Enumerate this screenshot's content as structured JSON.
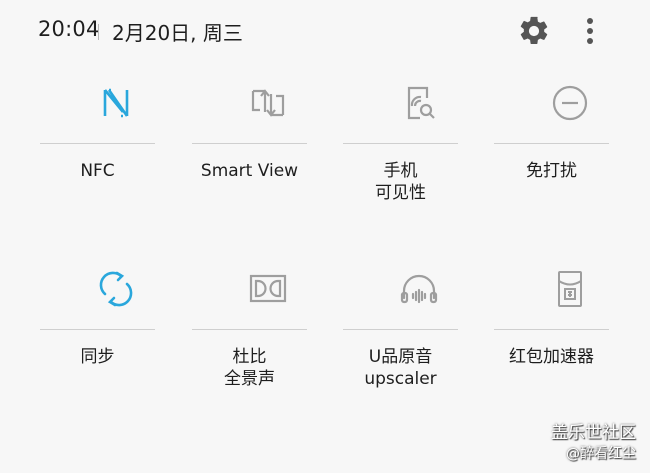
{
  "status": {
    "time": "20:04",
    "date": "2月20日, 周三"
  },
  "colors": {
    "active": "#2aa7dc",
    "inactive": "#9e9e9e",
    "background": "#f7f7f7"
  },
  "tiles": [
    {
      "label": "NFC",
      "icon": "nfc-icon",
      "active": true
    },
    {
      "label": "Smart View",
      "icon": "smart-view-icon",
      "active": false
    },
    {
      "label": "手机\n可见性",
      "icon": "phone-visibility-icon",
      "active": false
    },
    {
      "label": "免打扰",
      "icon": "do-not-disturb-icon",
      "active": false
    },
    {
      "label": "同步",
      "icon": "sync-icon",
      "active": true
    },
    {
      "label": "杜比\n全景声",
      "icon": "dolby-atmos-icon",
      "active": false
    },
    {
      "label": "U品原音\nupscaler",
      "icon": "uhq-upscaler-icon",
      "active": false
    },
    {
      "label": "红包加速器",
      "icon": "red-envelope-icon",
      "active": false
    }
  ],
  "watermark": {
    "line1": "盖乐世社区",
    "line2": "@醉看红尘"
  }
}
